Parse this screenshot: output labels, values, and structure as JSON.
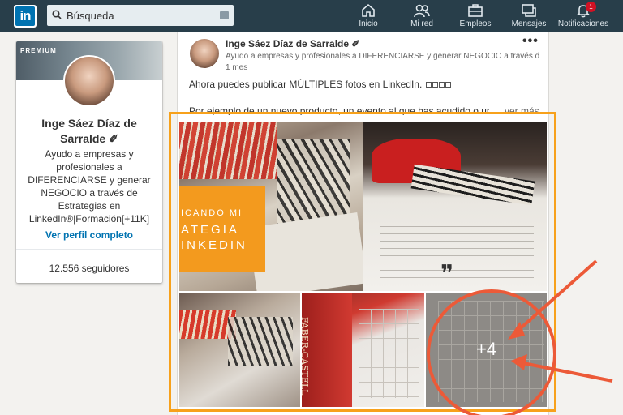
{
  "nav": {
    "logo": "in",
    "search_placeholder": "Búsqueda",
    "items": [
      {
        "label": "Inicio",
        "icon": "home-icon"
      },
      {
        "label": "Mi red",
        "icon": "network-icon"
      },
      {
        "label": "Empleos",
        "icon": "briefcase-icon"
      },
      {
        "label": "Mensajes",
        "icon": "messages-icon"
      },
      {
        "label": "Notificaciones",
        "icon": "bell-icon",
        "badge": "1"
      }
    ]
  },
  "profile": {
    "cover_label": "PREMIUM",
    "name": "Inge Sáez Díaz de Sarralde ✐",
    "headline": "Ayudo a empresas y profesionales a DIFERENCIARSE y generar NEGOCIO a través de Estrategias en LinkedIn®|Formación[+11K]",
    "view_profile": "Ver perfil completo",
    "followers": "12.556 seguidores"
  },
  "post": {
    "author": "Inge Sáez Díaz de Sarralde ✐",
    "headline": "Ayudo a empresas y profesionales a DIFERENCIARSE y generar NEGOCIO a través de...",
    "time": "1 mes",
    "text1": "Ahora puedes publicar MÚLTIPLES fotos en LinkedIn.",
    "text2": "Por ejemplo de un nuevo producto, un evento al que has acudido o una...",
    "see_more": "...ver más",
    "image_card": {
      "line1": "ICANDO MI",
      "line2": "ATEGIA",
      "line3": "INKEDIN"
    },
    "image_brand": "FABER-CASTELL",
    "more_photos": "+4"
  },
  "colors": {
    "nav_bg": "#283e4a",
    "brand_blue": "#0073b1",
    "highlight_orange": "#f7a11b",
    "annotation_red": "#ec5a38"
  }
}
